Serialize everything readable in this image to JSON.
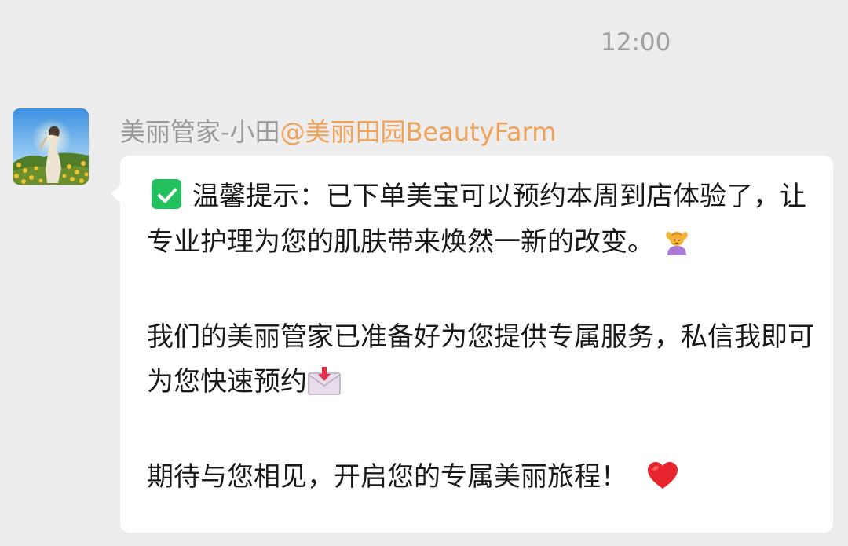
{
  "chat": {
    "timestamp": "12:00"
  },
  "message": {
    "sender_name": "美丽管家-小田",
    "sender_org": "@美丽田园BeautyFarm",
    "avatar_icon": "woman-in-flower-field-photo",
    "paragraph1_text": "温馨提示：已下单美宝可以预约本周到店体验了，让专业护理为您的肌肤带来焕然一新的改变。",
    "paragraph1_icon_start": "white-check-mark-icon",
    "paragraph1_icon_end": "face-massage-icon",
    "paragraph2_text": "我们的美丽管家已准备好为您提供专属服务，私信我即可为您快速预约",
    "paragraph2_icon_end": "envelope-with-arrow-icon",
    "paragraph3_text": "期待与您相见，开启您的专属美丽旅程！",
    "paragraph3_icon_end": "red-heart-icon",
    "colors": {
      "background": "#ededed",
      "bubble": "#ffffff",
      "sender_name": "#9a9a9a",
      "sender_org": "#f0a259",
      "check_green": "#23c25e",
      "heart_red": "#e8242e"
    }
  }
}
